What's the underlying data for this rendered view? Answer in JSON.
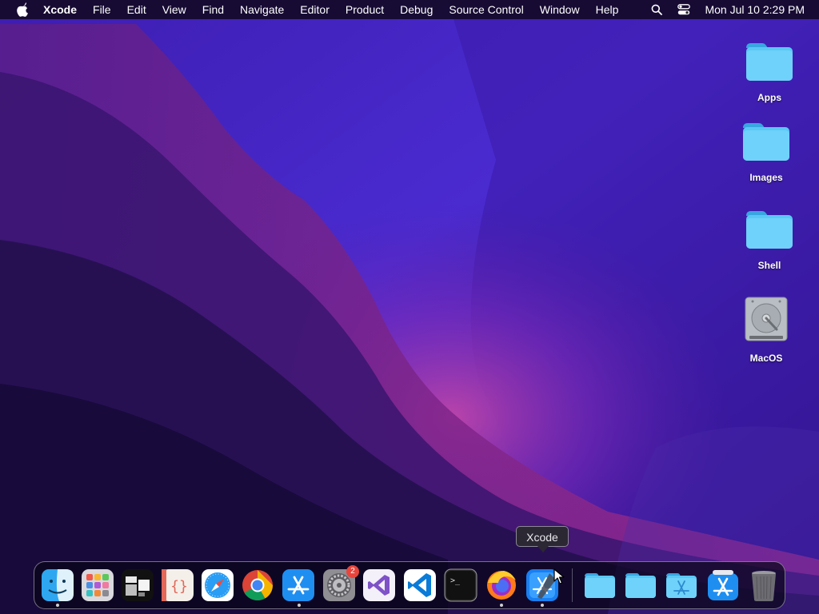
{
  "menubar": {
    "app_name": "Xcode",
    "menus": [
      "File",
      "Edit",
      "View",
      "Find",
      "Navigate",
      "Editor",
      "Product",
      "Debug",
      "Source Control",
      "Window",
      "Help"
    ],
    "clock": "Mon Jul 10  2:29 PM"
  },
  "desktop": {
    "icons": [
      {
        "label": "Apps",
        "icon": "folder-icon"
      },
      {
        "label": "Images",
        "icon": "folder-icon"
      },
      {
        "label": "Shell",
        "icon": "folder-icon"
      },
      {
        "label": "MacOS",
        "icon": "hard-drive-icon"
      }
    ]
  },
  "tooltip": {
    "text": "Xcode"
  },
  "dock": {
    "items": [
      {
        "name": "Finder",
        "icon": "finder-icon",
        "running": true
      },
      {
        "name": "Launchpad",
        "icon": "launchpad-icon",
        "running": false
      },
      {
        "name": "Window Manager",
        "icon": "window-manager-icon",
        "running": false
      },
      {
        "name": "Code Editor",
        "icon": "code-braces-icon",
        "running": false
      },
      {
        "name": "Safari",
        "icon": "safari-icon",
        "running": false
      },
      {
        "name": "Chrome",
        "icon": "chrome-icon",
        "running": false
      },
      {
        "name": "App Store",
        "icon": "app-store-icon",
        "running": true
      },
      {
        "name": "System Settings",
        "icon": "settings-gear-icon",
        "running": false,
        "badge": "2"
      },
      {
        "name": "Visual Studio",
        "icon": "visual-studio-icon",
        "running": false
      },
      {
        "name": "VS Code",
        "icon": "vscode-icon",
        "running": false
      },
      {
        "name": "Terminal",
        "icon": "terminal-icon",
        "running": false
      },
      {
        "name": "Firefox",
        "icon": "firefox-icon",
        "running": true
      },
      {
        "name": "Xcode",
        "icon": "xcode-icon",
        "running": true
      },
      {
        "name": "Applications",
        "icon": "folder-icon",
        "running": false
      },
      {
        "name": "Documents",
        "icon": "folder-icon",
        "running": false
      },
      {
        "name": "Applications Folder",
        "icon": "app-folder-icon",
        "running": false
      },
      {
        "name": "App Store Downloads",
        "icon": "app-store-icon",
        "running": false
      },
      {
        "name": "Trash",
        "icon": "trash-icon",
        "running": false
      }
    ]
  },
  "colors": {
    "folder_blue": "#5ac8f5",
    "badge_red": "#e8453c"
  }
}
